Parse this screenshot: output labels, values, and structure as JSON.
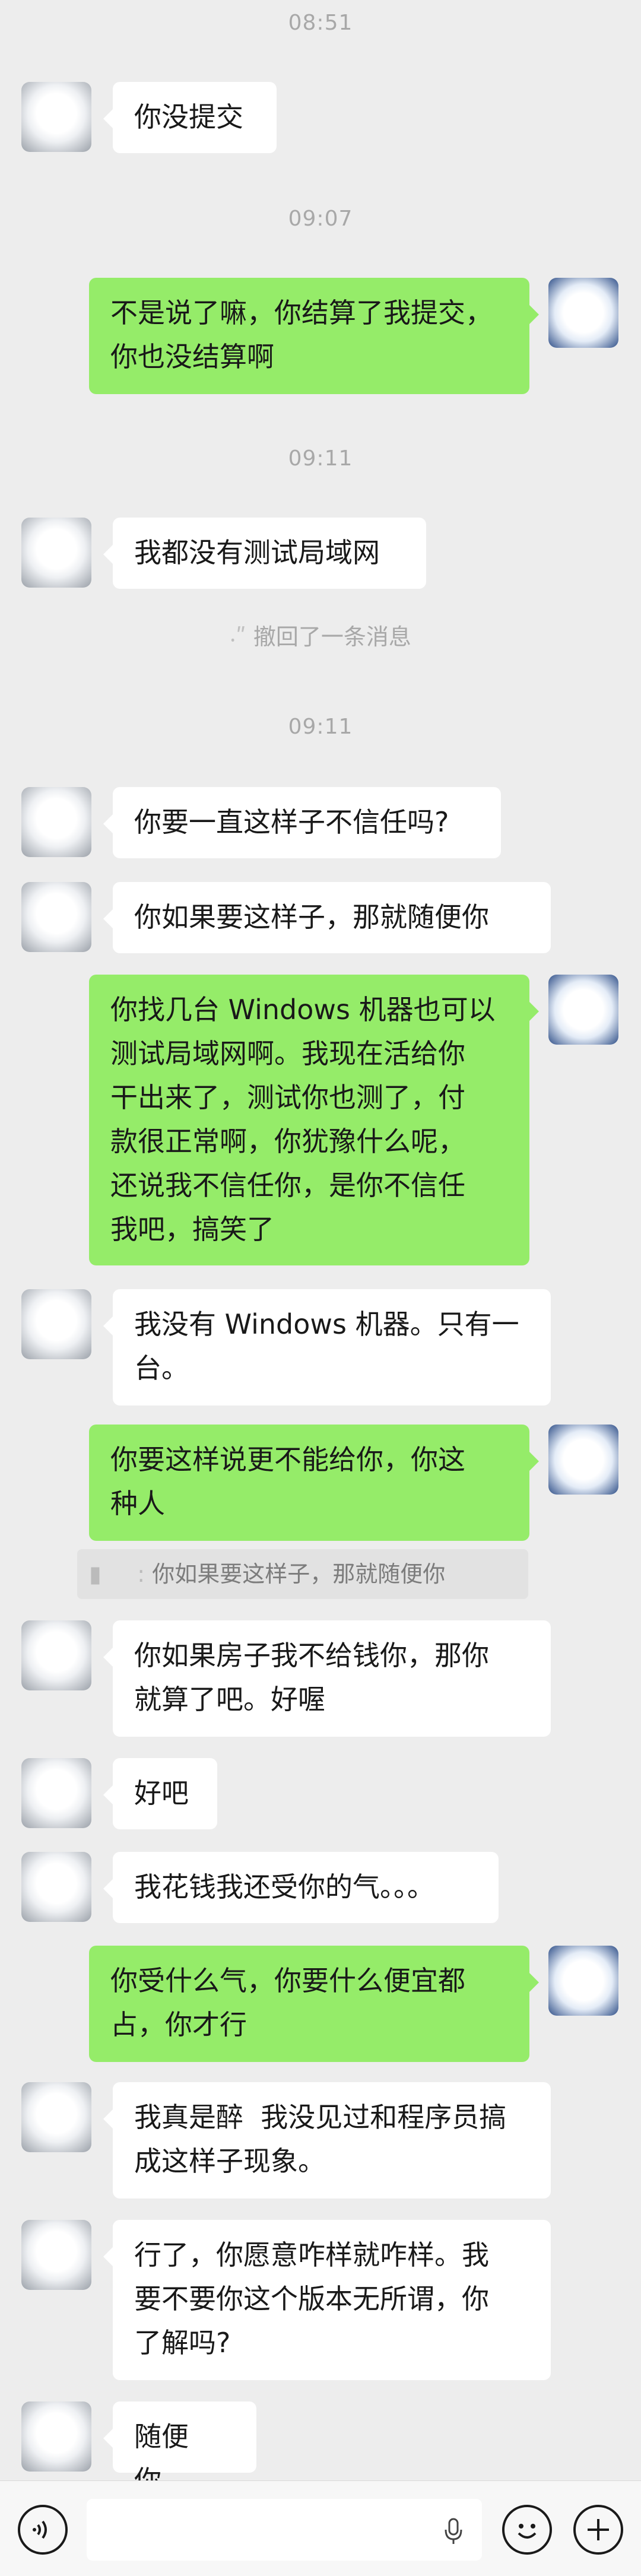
{
  "timestamps": [
    "08:51",
    "09:07",
    "09:11",
    "09:11"
  ],
  "messages": [
    {
      "side": "left",
      "text": "你没提交"
    },
    {
      "side": "right",
      "text": "不是说了嘛，你结算了我提交，\n你也没结算啊"
    },
    {
      "side": "left",
      "text": "我都没有测试局域网"
    },
    {
      "side": "left",
      "text": "你要一直这样子不信任吗?"
    },
    {
      "side": "left",
      "text": "你如果要这样子，那就随便你"
    },
    {
      "side": "right",
      "text": "你找几台 Windows 机器也可以\n测试局域网啊。我现在活给你\n干出来了，测试你也测了，付\n款很正常啊，你犹豫什么呢，\n还说我不信任你，是你不信任\n我吧，搞笑了"
    },
    {
      "side": "left",
      "text": "我没有 Windows 机器。只有一\n台。"
    },
    {
      "side": "right",
      "text": "你要这样说更不能给你，你这\n种人"
    },
    {
      "side": "left",
      "text": "你如果房子我不给钱你，那你\n就算了吧。好喔"
    },
    {
      "side": "left",
      "text": "好吧"
    },
    {
      "side": "left",
      "text": "我花钱我还受你的气。。。"
    },
    {
      "side": "right",
      "text": "你受什么气，你要什么便宜都\n占，你才行"
    },
    {
      "side": "left",
      "text": "我真是醉  我没见过和程序员搞\n成这样子现象。"
    },
    {
      "side": "left",
      "text": "行了，你愿意咋样就咋样。我\n要不要你这个版本无所谓，你\n了解吗?"
    },
    {
      "side": "left",
      "text": "随便你。"
    }
  ],
  "recall_notice": "撤回了一条消息",
  "quote_text": "你如果要这样子，那就随便你",
  "input": {
    "placeholder": ""
  },
  "colors": {
    "background": "#ededed",
    "green_bubble": "#95ec69",
    "white_bubble": "#ffffff"
  }
}
